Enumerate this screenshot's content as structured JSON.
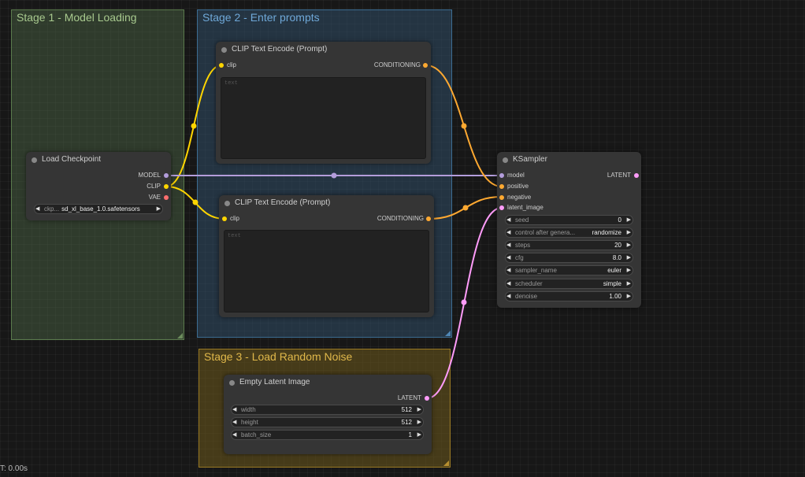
{
  "groups": {
    "stage1": "Stage 1 - Model Loading",
    "stage2": "Stage 2 - Enter prompts",
    "stage3": "Stage 3 - Load Random Noise"
  },
  "clip_positive": {
    "title": "CLIP Text Encode (Prompt)",
    "input": "clip",
    "output": "CONDITIONING",
    "placeholder": "text"
  },
  "clip_negative": {
    "title": "CLIP Text Encode (Prompt)",
    "input": "clip",
    "output": "CONDITIONING",
    "placeholder": "text"
  },
  "load_checkpoint": {
    "title": "Load Checkpoint",
    "outputs": [
      "MODEL",
      "CLIP",
      "VAE"
    ],
    "ckpt_label": "ckp...",
    "ckpt_value": "sd_xl_base_1.0.safetensors"
  },
  "ksampler": {
    "title": "KSampler",
    "inputs": [
      "model",
      "positive",
      "negative",
      "latent_image"
    ],
    "output": "LATENT",
    "widgets": [
      {
        "name": "seed",
        "value": "0"
      },
      {
        "name": "control after genera...",
        "value": "randomize"
      },
      {
        "name": "steps",
        "value": "20"
      },
      {
        "name": "cfg",
        "value": "8.0"
      },
      {
        "name": "sampler_name",
        "value": "euler"
      },
      {
        "name": "scheduler",
        "value": "simple"
      },
      {
        "name": "denoise",
        "value": "1.00"
      }
    ]
  },
  "empty_latent": {
    "title": "Empty Latent Image",
    "output": "LATENT",
    "widgets": [
      {
        "name": "width",
        "value": "512"
      },
      {
        "name": "height",
        "value": "512"
      },
      {
        "name": "batch_size",
        "value": "1"
      }
    ]
  },
  "status": {
    "timer": "T: 0.00s"
  },
  "colors": {
    "clip": "#ffd500",
    "conditioning": "#ffa931",
    "model": "#b39ddb",
    "latent": "#ff9cf9",
    "vae": "#ff6e6e"
  },
  "icons": {
    "arrow_left": "◀",
    "arrow_right": "▶"
  }
}
